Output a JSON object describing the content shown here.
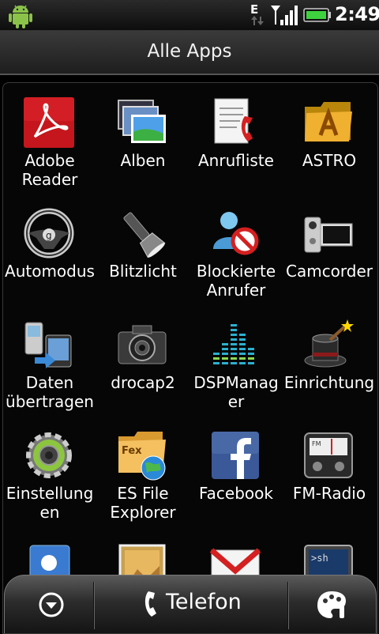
{
  "status_bar": {
    "network": "E",
    "time": "2:49"
  },
  "title": "Alle Apps",
  "apps": [
    {
      "label": "Adobe Reader",
      "icon": "adobe-reader-icon"
    },
    {
      "label": "Alben",
      "icon": "photo-albums-icon"
    },
    {
      "label": "Anrufliste",
      "icon": "call-log-icon"
    },
    {
      "label": "ASTRO",
      "icon": "astro-folder-icon"
    },
    {
      "label": "Automodus",
      "icon": "steering-wheel-icon"
    },
    {
      "label": "Blitzlicht",
      "icon": "flashlight-icon"
    },
    {
      "label": "Blockierte Anrufer",
      "icon": "blocked-caller-icon"
    },
    {
      "label": "Camcorder",
      "icon": "camcorder-icon"
    },
    {
      "label": "Daten übertragen",
      "icon": "transfer-data-icon"
    },
    {
      "label": "drocap2",
      "icon": "camera-icon"
    },
    {
      "label": "DSPManager",
      "icon": "equalizer-icon"
    },
    {
      "label": "Einrichtung",
      "icon": "magic-hat-icon"
    },
    {
      "label": "Einstellungen",
      "icon": "settings-gear-icon"
    },
    {
      "label": "ES File Explorer",
      "icon": "file-explorer-icon"
    },
    {
      "label": "Facebook",
      "icon": "facebook-icon"
    },
    {
      "label": "FM-Radio",
      "icon": "radio-icon"
    },
    {
      "label": "",
      "icon": "contacts-icon"
    },
    {
      "label": "",
      "icon": "gallery-icon"
    },
    {
      "label": "",
      "icon": "gmail-icon"
    },
    {
      "label": "",
      "icon": "terminal-icon"
    }
  ],
  "dock": {
    "phone_label": "Telefon"
  },
  "colors": {
    "facebook": "#3b5998",
    "adobe": "#c4161c",
    "battery": "#3fd23f"
  }
}
